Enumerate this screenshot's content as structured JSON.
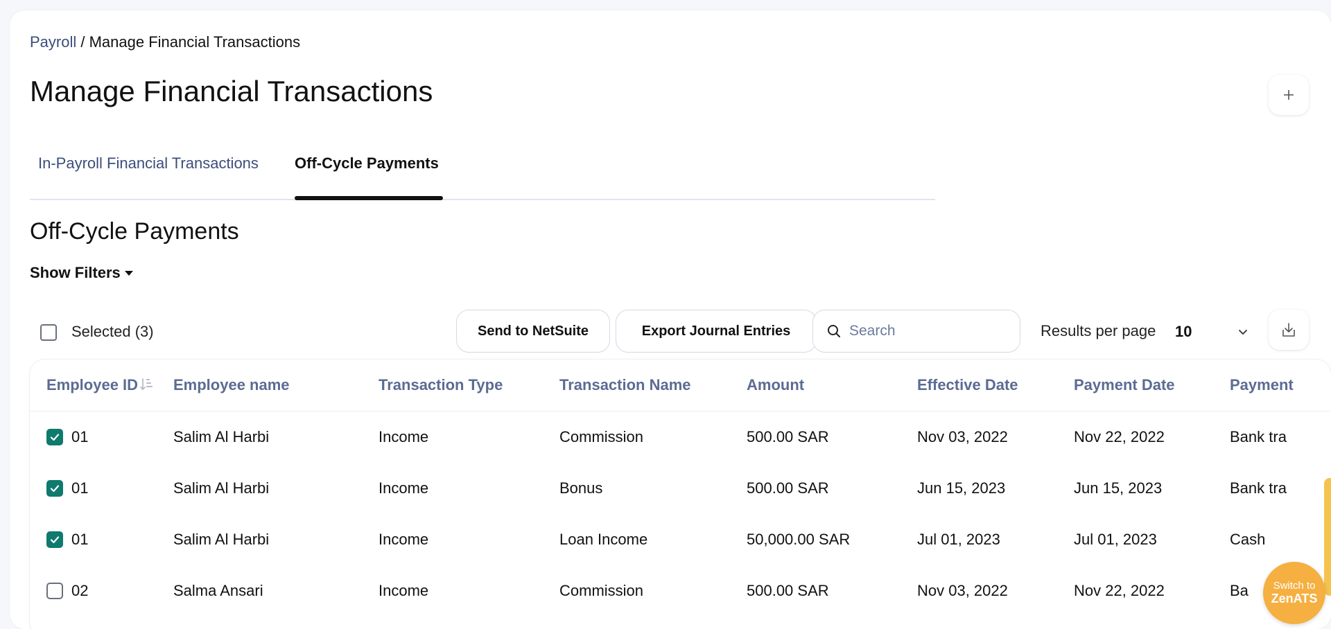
{
  "breadcrumb": {
    "parent": "Payroll",
    "separator": " / ",
    "current": "Manage Financial Transactions"
  },
  "page": {
    "title": "Manage Financial Transactions",
    "add_icon": "plus-icon"
  },
  "tabs": [
    {
      "label": "In-Payroll Financial Transactions",
      "active": false
    },
    {
      "label": "Off-Cycle Payments",
      "active": true
    }
  ],
  "section": {
    "title": "Off-Cycle Payments",
    "filters_label": "Show Filters"
  },
  "toolbar": {
    "selected_label": "Selected (3)",
    "send_netsuite_label": "Send to NetSuite",
    "export_label": "Export Journal Entries",
    "search_placeholder": "Search",
    "results_label": "Results per page",
    "results_value": "10"
  },
  "table": {
    "headers": [
      "Employee ID",
      "Employee name",
      "Transaction Type",
      "Transaction Name",
      "Amount",
      "Effective Date",
      "Payment Date",
      "Payment"
    ],
    "rows": [
      {
        "checked": true,
        "cells": [
          "01",
          "Salim Al Harbi",
          "Income",
          "Commission",
          "500.00 SAR",
          "Nov 03, 2022",
          "Nov 22, 2022",
          "Bank tra"
        ]
      },
      {
        "checked": true,
        "cells": [
          "01",
          "Salim Al Harbi",
          "Income",
          "Bonus",
          "500.00 SAR",
          "Jun 15, 2023",
          "Jun 15, 2023",
          "Bank tra"
        ]
      },
      {
        "checked": true,
        "cells": [
          "01",
          "Salim Al Harbi",
          "Income",
          "Loan Income",
          "50,000.00 SAR",
          "Jul 01, 2023",
          "Jul 01, 2023",
          "Cash"
        ]
      },
      {
        "checked": false,
        "cells": [
          "02",
          "Salma Ansari",
          "Income",
          "Commission",
          "500.00 SAR",
          "Nov 03, 2022",
          "Nov 22, 2022",
          "Ba"
        ]
      }
    ]
  },
  "switch_badge": {
    "line1": "Switch to",
    "line2": "ZenATS"
  },
  "colors": {
    "accent_teal": "#0f7a6e",
    "link_blue": "#3b4d7a",
    "badge_orange": "#f5b041"
  }
}
